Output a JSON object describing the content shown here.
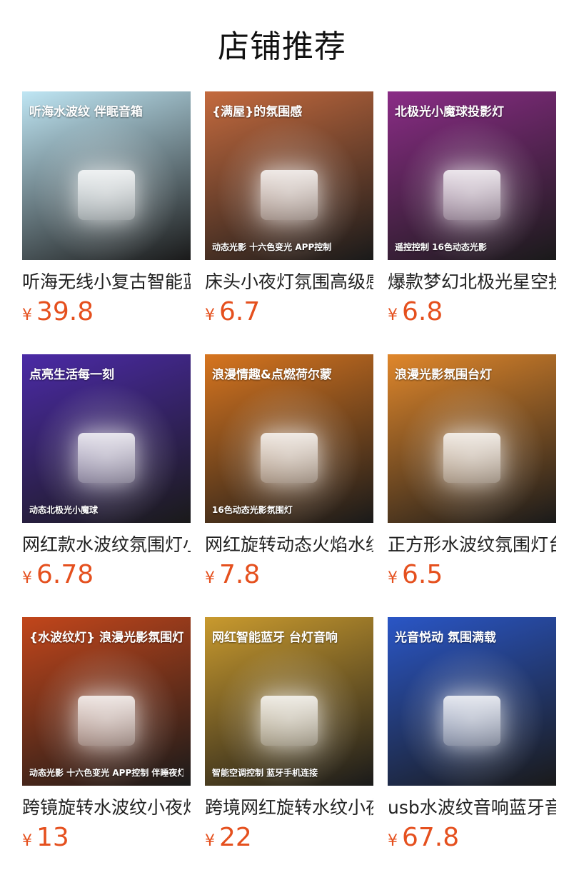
{
  "page_title": "店铺推荐",
  "products": [
    {
      "name": "听海无线小复古智能蓝牙音箱",
      "currency": "¥",
      "price": "39.8",
      "banner": "听海水波纹 伴眠音箱",
      "sub": "",
      "bg": "#bfe6f4"
    },
    {
      "name": "床头小夜灯氛围高级感",
      "currency": "¥",
      "price": "6.7",
      "banner": "{满屋}的氛围感",
      "sub": "动态光影 十六色变光 APP控制",
      "bg": "#c46a3e"
    },
    {
      "name": "爆款梦幻北极光星空投影灯",
      "currency": "¥",
      "price": "6.8",
      "banner": "北极光小魔球投影灯",
      "sub": "遥控控制 16色动态光影",
      "bg": "#8a2c86"
    },
    {
      "name": "网红款水波纹氛围灯小魔球",
      "currency": "¥",
      "price": "6.78",
      "banner": "点亮生活每一刻",
      "sub": "动态北极光小魔球",
      "bg": "#4b2aa6"
    },
    {
      "name": "网红旋转动态火焰水纹灯",
      "currency": "¥",
      "price": "7.8",
      "banner": "浪漫情趣&点燃荷尔蒙",
      "sub": "16色动态光影氛围灯",
      "bg": "#d7751f"
    },
    {
      "name": "正方形水波纹氛围灯台灯",
      "currency": "¥",
      "price": "6.5",
      "banner": "浪漫光影氛围台灯",
      "sub": "",
      "bg": "#e0872b"
    },
    {
      "name": "跨镜旋转水波纹小夜灯",
      "currency": "¥",
      "price": "13",
      "banner": "{水波纹灯} 浪漫光影氛围灯",
      "sub": "动态光影 十六色变光 APP控制 伴睡夜灯",
      "bg": "#c2461b"
    },
    {
      "name": "跨境网红旋转水纹小夜灯",
      "currency": "¥",
      "price": "22",
      "banner": "网红智能蓝牙 台灯音响",
      "sub": "智能空调控制 蓝牙手机连接",
      "bg": "#c99a2e"
    },
    {
      "name": "usb水波纹音响蓝牙音箱",
      "currency": "¥",
      "price": "67.8",
      "banner": "光音悦动 氛围满载",
      "sub": "",
      "bg": "#2a56c6"
    }
  ],
  "colors": {
    "price": "#e5501e",
    "text": "#222222"
  }
}
